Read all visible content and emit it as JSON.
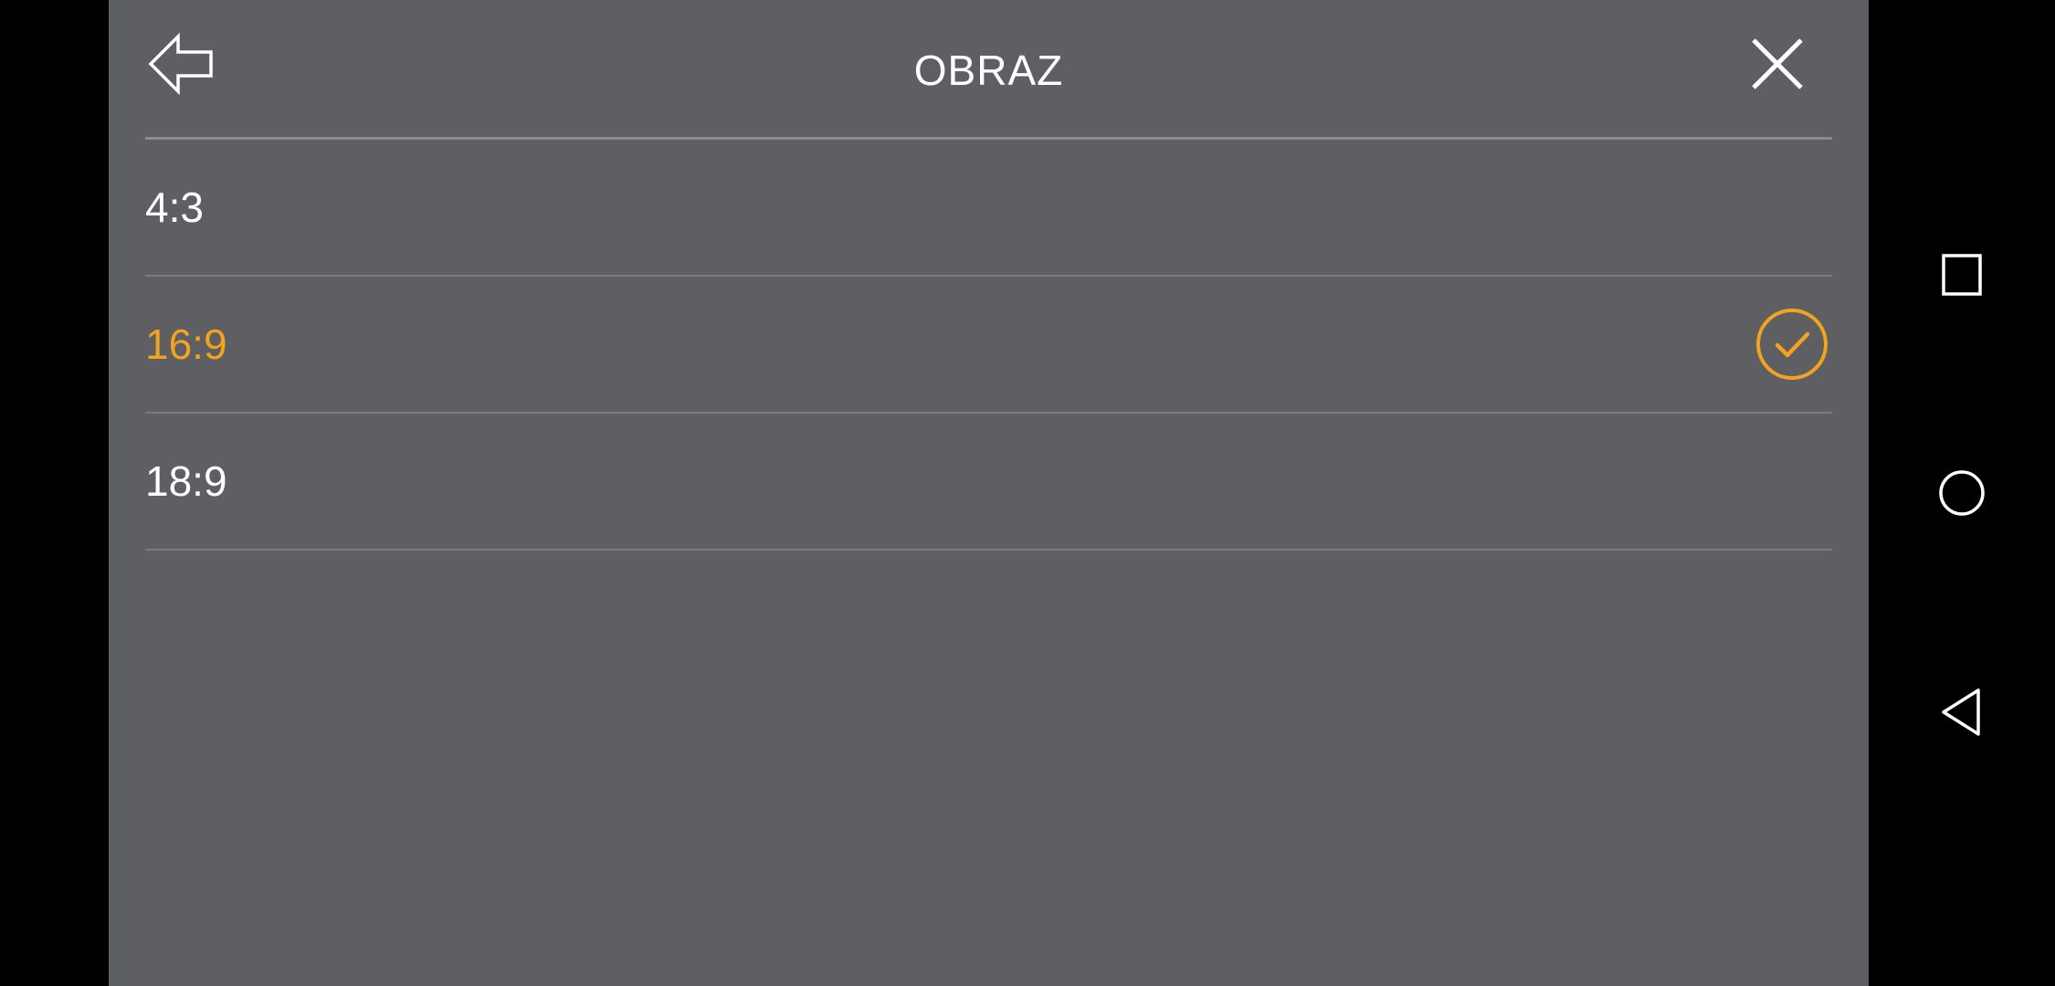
{
  "header": {
    "title": "OBRAZ",
    "back_icon": "back-arrow-icon",
    "close_icon": "close-icon"
  },
  "options": [
    {
      "label": "4:3",
      "selected": false
    },
    {
      "label": "16:9",
      "selected": true
    },
    {
      "label": "18:9",
      "selected": false
    }
  ],
  "navbar": {
    "recents_icon": "square-icon",
    "home_icon": "circle-icon",
    "back_icon": "triangle-back-icon"
  },
  "colors": {
    "panel_bg": "#5e5f63",
    "accent": "#f2a31f",
    "text": "#ffffff",
    "divider": "#7b7c80"
  }
}
